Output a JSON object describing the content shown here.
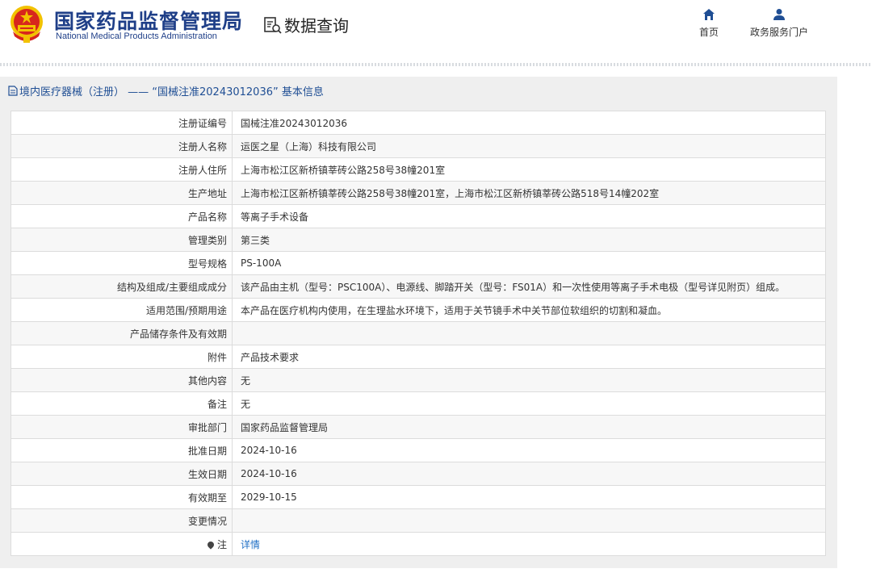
{
  "header": {
    "brand_cn": "国家药品监督管理局",
    "brand_en": "National Medical Products Administration",
    "query_label": "数据查询",
    "nav": [
      {
        "label": "首页",
        "icon": "home-icon"
      },
      {
        "label": "政务服务门户",
        "icon": "user-icon"
      }
    ]
  },
  "panel": {
    "title": "境内医疗器械（注册） ——  “国械注准20243012036” 基本信息"
  },
  "rows": [
    {
      "label": "注册证编号",
      "value": "国械注准20243012036"
    },
    {
      "label": "注册人名称",
      "value": "运医之星（上海）科技有限公司"
    },
    {
      "label": "注册人住所",
      "value": "上海市松江区新桥镇莘砖公路258号38幢201室"
    },
    {
      "label": "生产地址",
      "value": "上海市松江区新桥镇莘砖公路258号38幢201室，上海市松江区新桥镇莘砖公路518号14幢202室"
    },
    {
      "label": "产品名称",
      "value": "等离子手术设备"
    },
    {
      "label": "管理类别",
      "value": "第三类"
    },
    {
      "label": "型号规格",
      "value": "PS-100A"
    },
    {
      "label": "结构及组成/主要组成成分",
      "value": "该产品由主机（型号：PSC100A）、电源线、脚踏开关（型号：FS01A）和一次性使用等离子手术电极（型号详见附页）组成。"
    },
    {
      "label": "适用范围/预期用途",
      "value": "本产品在医疗机构内使用，在生理盐水环境下，适用于关节镜手术中关节部位软组织的切割和凝血。"
    },
    {
      "label": "产品储存条件及有效期",
      "value": ""
    },
    {
      "label": "附件",
      "value": "产品技术要求"
    },
    {
      "label": "其他内容",
      "value": "无"
    },
    {
      "label": "备注",
      "value": "无"
    },
    {
      "label": "审批部门",
      "value": "国家药品监督管理局"
    },
    {
      "label": "批准日期",
      "value": "2024-10-16"
    },
    {
      "label": "生效日期",
      "value": "2024-10-16"
    },
    {
      "label": "有效期至",
      "value": "2029-10-15"
    },
    {
      "label": "变更情况",
      "value": ""
    }
  ],
  "note_row": {
    "label": "注",
    "link": "详情",
    "icon": "pin-icon"
  },
  "colors": {
    "brand_blue": "#1f3f88",
    "title_blue": "#1f4e94",
    "link_blue": "#1f6fc5",
    "emblem_red": "#d7261d",
    "emblem_gold": "#f2c200"
  }
}
